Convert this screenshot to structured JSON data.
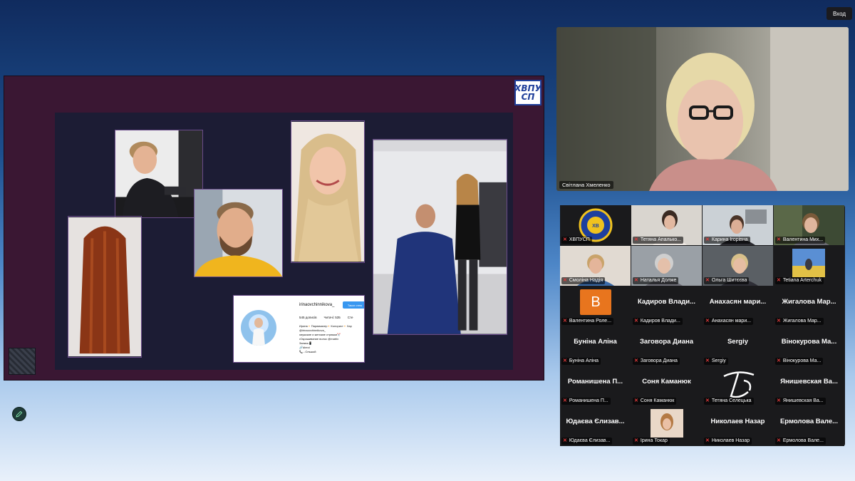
{
  "toolbar": {
    "exit_label": "Вход"
  },
  "share": {
    "logo_top": "ХВПУ",
    "logo_bottom": "СП",
    "instagram": {
      "username": "irinaovchinnikova_",
      "follow_label": "Такоє стеж",
      "posts": "545 дописів",
      "readers": "Читачі: 535",
      "following": "Сте",
      "bio_lines": [
        "Ирина🔸Парикмахер🔸Колорист🔸Хар",
        "@irinaovchinnikova_",
        "•мужские и женские стрижки✂️",
        "•Окрашивание волос @matrix",
        "Запись📱",
        "🔗direct",
        "📞...Ольшой"
      ]
    }
  },
  "speaker": {
    "name": "Світлана Хмеленко"
  },
  "participants": [
    {
      "label": "ХВПУСП",
      "type": "logo"
    },
    {
      "label": "Тетяна Апалько...",
      "type": "video"
    },
    {
      "label": "Карина Ігорівна",
      "type": "video"
    },
    {
      "label": "Валентина Мих...",
      "type": "video"
    },
    {
      "label": "Смоліна Надія",
      "type": "video"
    },
    {
      "label": "Наталья Должe",
      "type": "video"
    },
    {
      "label": "Ольга Шитєєва",
      "type": "video"
    },
    {
      "label": "Tetiana Arterchuk",
      "type": "video"
    },
    {
      "label": "Валентина Роле...",
      "type": "avatar",
      "initial": "В"
    },
    {
      "label": "Кадиров Влади...",
      "type": "name",
      "big": "Кадиров Влади..."
    },
    {
      "label": "Анахасян мари...",
      "type": "name",
      "big": "Анахасян мари..."
    },
    {
      "label": "Жигалова Мар...",
      "type": "name",
      "big": "Жигалова Мар..."
    },
    {
      "label": "Буніна Аліна",
      "type": "name",
      "big": "Буніна Аліна"
    },
    {
      "label": "Заговора Диана",
      "type": "name",
      "big": "Заговора Диана"
    },
    {
      "label": "Sergiy",
      "type": "name",
      "big": "Sergiy"
    },
    {
      "label": "Вінокурова Ма...",
      "type": "name",
      "big": "Вінокурова Ма..."
    },
    {
      "label": "Романишена П...",
      "type": "name",
      "big": "Романишена П..."
    },
    {
      "label": "Соня Каманюк",
      "type": "name",
      "big": "Соня Каманюк"
    },
    {
      "label": "Тетяна Селецька",
      "type": "monogram"
    },
    {
      "label": "Янишевская Ва...",
      "type": "name",
      "big": "Янишевская Ва..."
    },
    {
      "label": "Юдаєва Єлизав...",
      "type": "name",
      "big": "Юдаєва Єлизав..."
    },
    {
      "label": "Ірина Токар",
      "type": "photo"
    },
    {
      "label": "Николаев Назар",
      "type": "name",
      "big": "Николаев Назар"
    },
    {
      "label": "Ермолова Вале...",
      "type": "name",
      "big": "Ермолова Вале..."
    }
  ]
}
